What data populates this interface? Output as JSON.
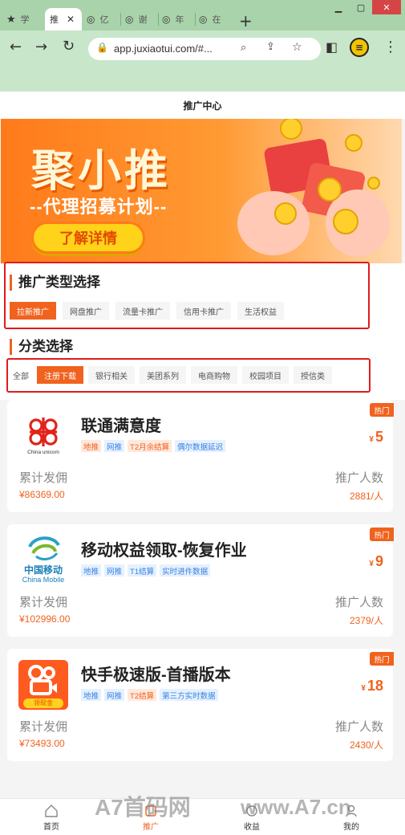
{
  "browser": {
    "tabs": [
      {
        "label": "学",
        "icon": "star-icon"
      },
      {
        "label": "推",
        "icon": "page-icon"
      },
      {
        "label": "亿",
        "icon": "globe-icon"
      },
      {
        "label": "谢",
        "icon": "globe-icon"
      },
      {
        "label": "年",
        "icon": "globe-icon"
      },
      {
        "label": "在",
        "icon": "globe-icon"
      }
    ],
    "address": "app.juxiaotui.com/#..."
  },
  "page": {
    "title": "推广中心",
    "banner": {
      "title": "聚小推",
      "subtitle": "--代理招募计划--",
      "button": "了解详情"
    },
    "promo_type": {
      "title": "推广类型选择",
      "options": [
        "拉新推广",
        "网盘推广",
        "流量卡推广",
        "信用卡推广",
        "生活权益"
      ],
      "selected": "拉新推广"
    },
    "category": {
      "title": "分类选择",
      "options": [
        "全部",
        "注册下载",
        "银行相关",
        "美团系列",
        "电商购物",
        "校园项目",
        "授信类"
      ],
      "selected": "注册下载"
    },
    "cards": [
      {
        "title": "联通满意度",
        "tags": [
          {
            "t": "地推",
            "c": "o"
          },
          {
            "t": "网推",
            "c": "b"
          },
          {
            "t": "T2月余结算",
            "c": "o"
          },
          {
            "t": "偶尔数据延迟",
            "c": "b"
          }
        ],
        "badge": "热门",
        "price_symbol": "¥",
        "price": "5",
        "commission_label": "累计发佣",
        "commission": "¥86369.00",
        "people_label": "推广人数",
        "people": "2881/人",
        "logo": "china-unicom-logo",
        "logo_text": "China unicom"
      },
      {
        "title": "移动权益领取-恢复作业",
        "tags": [
          {
            "t": "地推",
            "c": "b"
          },
          {
            "t": "网推",
            "c": "b"
          },
          {
            "t": "T1结算",
            "c": "b"
          },
          {
            "t": "实时进件数据",
            "c": "b"
          }
        ],
        "badge": "热门",
        "price_symbol": "¥",
        "price": "9",
        "commission_label": "累计发佣",
        "commission": "¥102996.00",
        "people_label": "推广人数",
        "people": "2379/人",
        "logo": "china-mobile-logo",
        "logo_text_cn": "中国移动",
        "logo_text": "China Mobile"
      },
      {
        "title": "快手极速版-首播版本",
        "tags": [
          {
            "t": "地推",
            "c": "b"
          },
          {
            "t": "网推",
            "c": "b"
          },
          {
            "t": "T2结算",
            "c": "o"
          },
          {
            "t": "第三方实时数据",
            "c": "b"
          }
        ],
        "badge": "热门",
        "price_symbol": "¥",
        "price": "18",
        "commission_label": "累计发佣",
        "commission": "¥73493.00",
        "people_label": "推广人数",
        "people": "2430/人",
        "logo": "kuaishou-logo",
        "logo_badge": "领现金"
      }
    ],
    "nav": [
      {
        "label": "首页",
        "icon": "home-icon"
      },
      {
        "label": "推广",
        "icon": "promote-icon"
      },
      {
        "label": "收益",
        "icon": "income-icon"
      },
      {
        "label": "我的",
        "icon": "profile-icon"
      }
    ],
    "watermark": {
      "left": "A7首码网",
      "right": "www.A7.cn"
    }
  },
  "colors": {
    "accent": "#f0621e",
    "highlight_box": "#e01b1b",
    "chrome": "#c8e6c9"
  }
}
